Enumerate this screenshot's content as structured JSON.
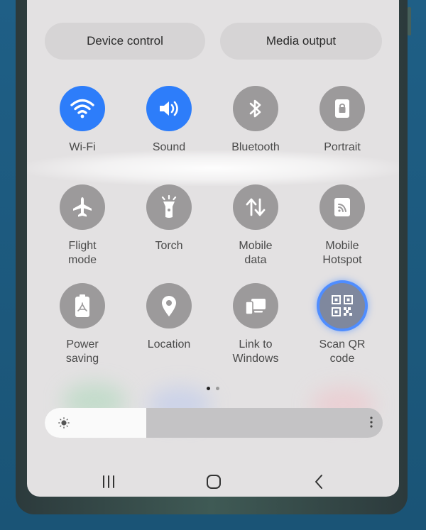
{
  "header": {
    "device_control": "Device control",
    "media_output": "Media output"
  },
  "tiles": [
    {
      "label": "Wi-Fi",
      "icon": "wifi-icon",
      "state": "on"
    },
    {
      "label": "Sound",
      "icon": "sound-icon",
      "state": "on"
    },
    {
      "label": "Bluetooth",
      "icon": "bluetooth-icon",
      "state": "off"
    },
    {
      "label": "Portrait",
      "icon": "portrait-lock-icon",
      "state": "off"
    },
    {
      "label": "Flight\nmode",
      "icon": "airplane-icon",
      "state": "off"
    },
    {
      "label": "Torch",
      "icon": "torch-icon",
      "state": "off"
    },
    {
      "label": "Mobile\ndata",
      "icon": "mobile-data-icon",
      "state": "off"
    },
    {
      "label": "Mobile\nHotspot",
      "icon": "hotspot-icon",
      "state": "off"
    },
    {
      "label": "Power\nsaving",
      "icon": "battery-saver-icon",
      "state": "off"
    },
    {
      "label": "Location",
      "icon": "location-pin-icon",
      "state": "off"
    },
    {
      "label": "Link to\nWindows",
      "icon": "link-to-windows-icon",
      "state": "off"
    },
    {
      "label": "Scan QR\ncode",
      "icon": "qr-code-icon",
      "state": "highlighted"
    }
  ],
  "pager": {
    "pages": 2,
    "current": 1
  },
  "brightness": {
    "level_percent": 30
  },
  "nav": {
    "recent": "recent-apps-icon",
    "home": "home-icon",
    "back": "back-icon"
  },
  "colors": {
    "accent": "#2d7dfa",
    "tile_off": "#9c9a9b",
    "panel_bg": "#e3e1e2",
    "highlight_ring": "#4f8dff"
  }
}
